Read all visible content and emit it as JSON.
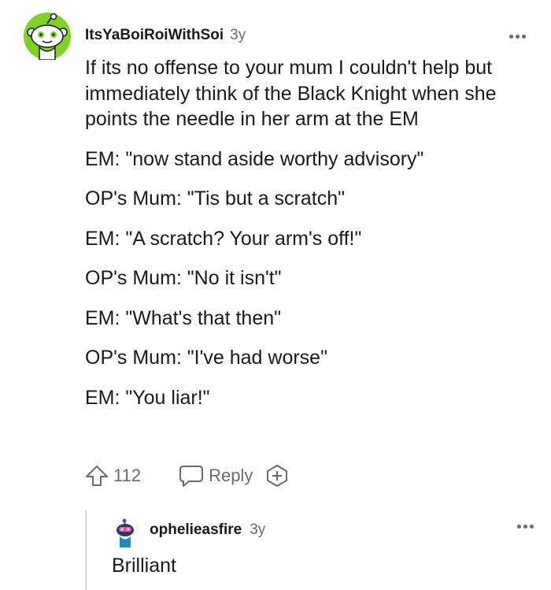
{
  "comment": {
    "username": "ItsYaBoiRoiWithSoi",
    "age": "3y",
    "paragraphs": [
      "If its no offense to your mum I couldn't help but immediately think of the Black Knight when she points the needle in her arm at the EM",
      "EM: \"now stand aside worthy advisory\"",
      "OP's Mum: \"Tis but a scratch\"",
      "EM: \"A scratch? Your arm's off!\"",
      "OP's Mum: \"No it isn't\"",
      "EM: \"What's that then\"",
      "OP's Mum: \"I've had worse\"",
      "EM: \"You liar!\""
    ],
    "upvotes": "112",
    "reply_label": "Reply"
  },
  "reply": {
    "username": "ophelieasfire",
    "age": "3y",
    "text": "Brilliant"
  },
  "icons": {
    "upvote": "upvote-arrow-icon",
    "reply": "speech-bubble-icon",
    "award": "add-award-icon",
    "more": "more-options-icon",
    "avatar_main": "snoo-avatar-icon",
    "avatar_reply": "snoo-avatar-icon"
  },
  "colors": {
    "text": "#1a1a1b",
    "muted": "#6a6a6a",
    "avatar_green": "#7ed321",
    "thread_line": "#d8d8d8"
  }
}
